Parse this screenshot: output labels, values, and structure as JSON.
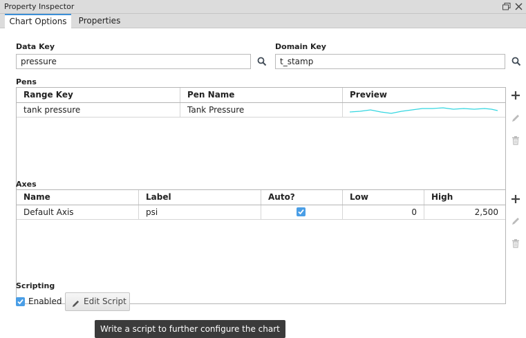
{
  "window": {
    "title": "Property Inspector"
  },
  "tabs": [
    {
      "label": "Chart Options",
      "active": true
    },
    {
      "label": "Properties",
      "active": false
    }
  ],
  "data_key": {
    "label": "Data Key",
    "value": "pressure"
  },
  "domain_key": {
    "label": "Domain Key",
    "value": "t_stamp"
  },
  "pens": {
    "label": "Pens",
    "columns": [
      "Range Key",
      "Pen Name",
      "Preview"
    ],
    "rows": [
      {
        "range_key": "tank pressure",
        "pen_name": "Tank Pressure",
        "preview_color": "#32d6e0"
      }
    ]
  },
  "axes": {
    "label": "Axes",
    "columns": [
      "Name",
      "Label",
      "Auto?",
      "Low",
      "High"
    ],
    "rows": [
      {
        "name": "Default Axis",
        "label": "psi",
        "auto": true,
        "low": "0",
        "high": "2,500"
      }
    ]
  },
  "scripting": {
    "label": "Scripting",
    "enabled_label": "Enabled",
    "enabled": true,
    "edit_button": "Edit Script",
    "tooltip": "Write a script to further configure the chart"
  },
  "colors": {
    "accent": "#3c8fd6",
    "checkbox": "#4a9ee6",
    "preview_line": "#32d6e0",
    "add_icon": "#444444",
    "disabled_icon": "#bbbbbb"
  }
}
